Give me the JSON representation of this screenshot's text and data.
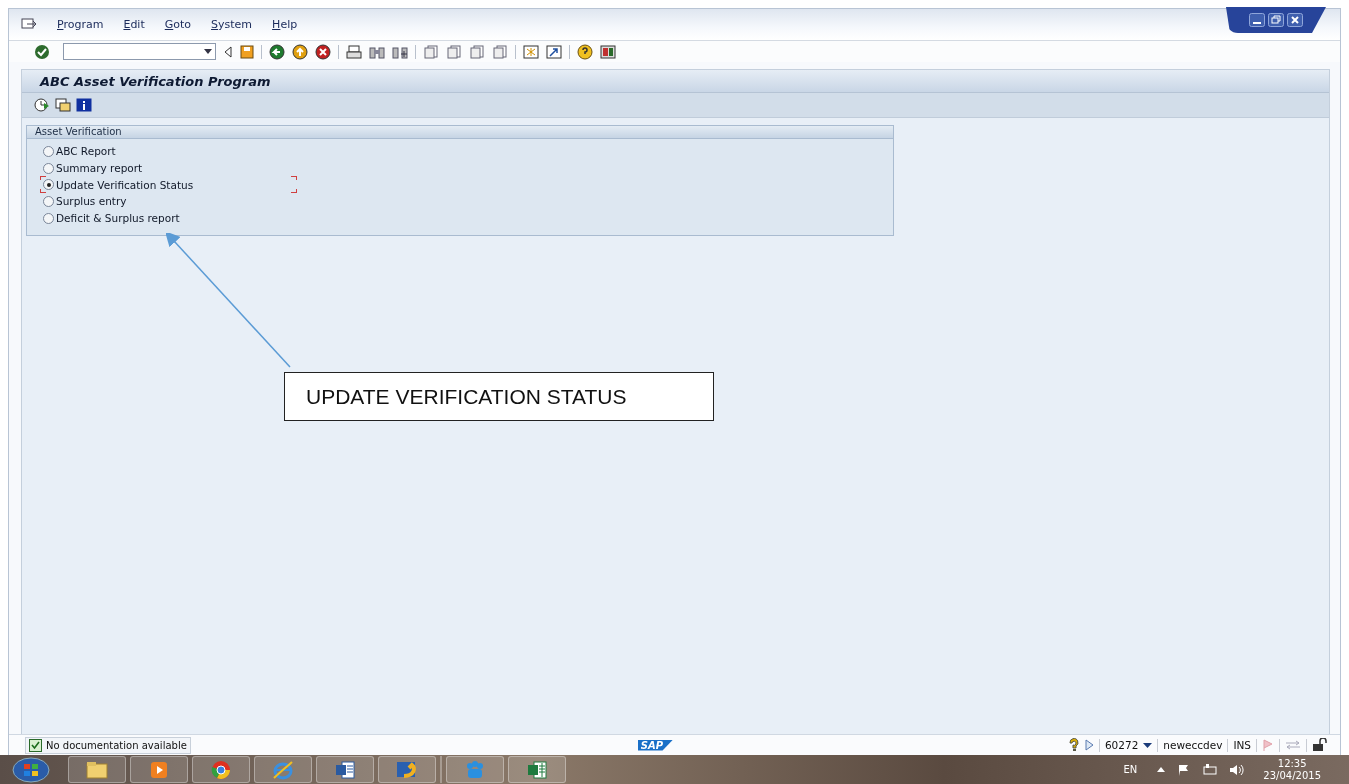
{
  "menu": [
    {
      "label": "Program"
    },
    {
      "label": "Edit"
    },
    {
      "label": "Goto"
    },
    {
      "label": "System"
    },
    {
      "label": "Help"
    }
  ],
  "screen_title": "ABC Asset Verification Program",
  "group": {
    "title": "Asset Verification",
    "options": [
      {
        "label": "ABC Report",
        "selected": false
      },
      {
        "label": "Summary report",
        "selected": false
      },
      {
        "label": "Update Verification Status",
        "selected": true
      },
      {
        "label": "Surplus entry",
        "selected": false
      },
      {
        "label": "Deficit & Surplus report",
        "selected": false
      }
    ]
  },
  "annotation": "UPDATE VERIFICATION STATUS",
  "status_bar": {
    "message": "No documentation available",
    "logo": "SAP",
    "session": "60272",
    "system": "neweccdev",
    "mode": "INS"
  },
  "taskbar": {
    "language": "EN",
    "time": "12:35",
    "date": "23/04/2015"
  }
}
